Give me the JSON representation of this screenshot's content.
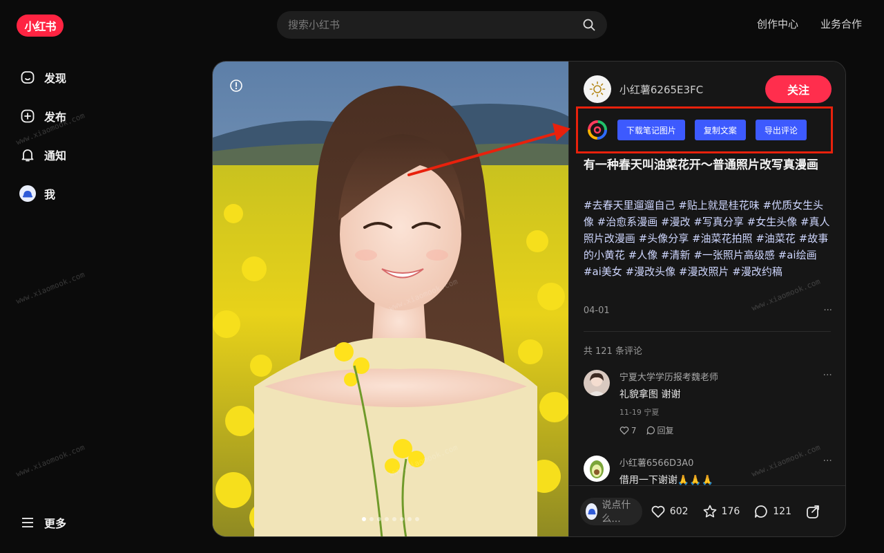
{
  "header": {
    "logo_text": "小红书",
    "search_placeholder": "搜索小红书",
    "links": [
      "创作中心",
      "业务合作"
    ]
  },
  "sidebar": {
    "items": [
      {
        "label": "发现",
        "icon": "home-icon"
      },
      {
        "label": "发布",
        "icon": "plus-square-icon"
      },
      {
        "label": "通知",
        "icon": "bell-icon"
      },
      {
        "label": "我",
        "icon": "avatar-icon"
      }
    ],
    "more_label": "更多"
  },
  "note": {
    "author": "小红薯6265E3FC",
    "follow_label": "关注",
    "tools": [
      "下载笔记图片",
      "复制文案",
      "导出评论"
    ],
    "title": "有一种春天叫油菜花开～普通照片改写真漫画",
    "desc": "#去春天里遛遛自己 #贴上就是桂花味 #优质女生头像 #治愈系漫画 #漫改 #写真分享 #女生头像 #真人照片改漫画 #头像分享 #油菜花拍照 #油菜花 #故事的小黄花 #人像 #清新 #一张照片高级感 #ai绘画 #ai美女 #漫改头像 #漫改照片 #漫改约稿",
    "date": "04-01",
    "more": "···",
    "image_count": 8,
    "active_image": 1
  },
  "comments": {
    "total_label": "共 121 条评论",
    "items": [
      {
        "name": "宁夏大学学历报考魏老师",
        "text": "礼貌拿图 谢谢",
        "meta": "11-19 宁夏",
        "likes": "7",
        "reply": "回复"
      },
      {
        "name": "小红薯6566D3A0",
        "text": "借用一下谢谢🙏🙏🙏"
      }
    ]
  },
  "bottom": {
    "input_placeholder": "说点什么...",
    "likes": "602",
    "collects": "176",
    "comments": "121"
  },
  "watermark": "www.xiaomook.com",
  "colors": {
    "brand": "#ff2442",
    "follow": "#ff2e4d",
    "tool_button": "#3d5afe",
    "highlight_box": "#e8210c",
    "hashtag": "#cfd7ff"
  }
}
